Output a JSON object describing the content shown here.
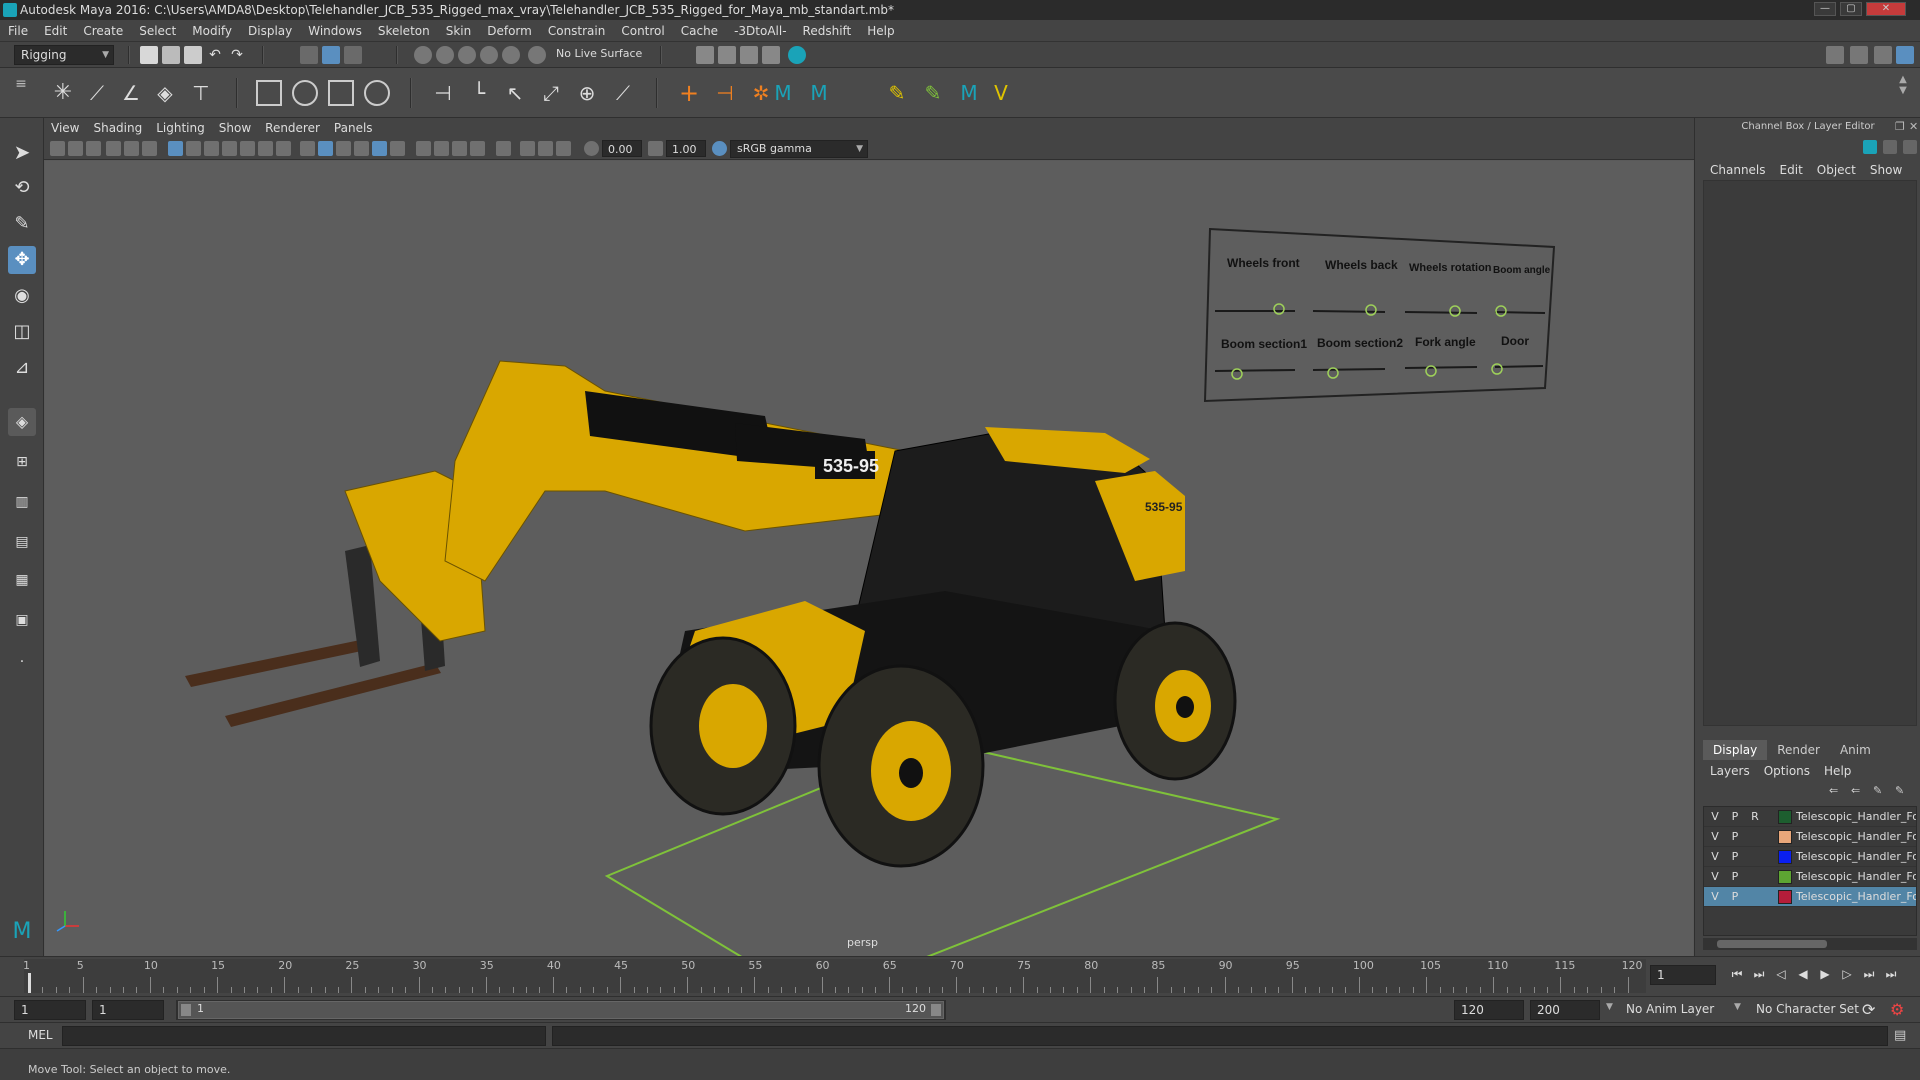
{
  "window": {
    "title": "Autodesk Maya 2016: C:\\Users\\AMDA8\\Desktop\\Telehandler_JCB_535_Rigged_max_vray\\Telehandler_JCB_535_Rigged_for_Maya_mb_standart.mb*",
    "minimize": "—",
    "maximize": "▢",
    "close": "✕"
  },
  "menubar": [
    "File",
    "Edit",
    "Create",
    "Select",
    "Modify",
    "Display",
    "Windows",
    "Skeleton",
    "Skin",
    "Deform",
    "Constrain",
    "Control",
    "Cache",
    "-3DtoAll-",
    "Redshift",
    "Help"
  ],
  "statusline": {
    "menu_set": "Rigging",
    "live_surface": "No Live Surface"
  },
  "viewport_menu": [
    "View",
    "Shading",
    "Lighting",
    "Show",
    "Renderer",
    "Panels"
  ],
  "viewport_toolbar": {
    "exposure": "0.00",
    "gamma": "1.00",
    "color_space": "sRGB gamma"
  },
  "viewport": {
    "camera_label": "persp",
    "control_panel": {
      "labels": [
        "Wheels front",
        "Wheels back",
        "Wheels rotation",
        "Boom angle",
        "Boom section1",
        "Boom section2",
        "Fork angle",
        "Door"
      ]
    },
    "model_badges": [
      "535-95",
      "535-95"
    ]
  },
  "channel_box": {
    "header": "Channel Box / Layer Editor",
    "tabs": [
      "Channels",
      "Edit",
      "Object",
      "Show"
    ]
  },
  "layer_editor": {
    "tabs": [
      "Display",
      "Render",
      "Anim"
    ],
    "active_tab": "Display",
    "menu": [
      "Layers",
      "Options",
      "Help"
    ],
    "layers": [
      {
        "v": "V",
        "p": "P",
        "r": "R",
        "color": "#1d5e2f",
        "name": "Telescopic_Handler_Fo",
        "selected": false
      },
      {
        "v": "V",
        "p": "P",
        "r": "",
        "color": "#e9a77a",
        "name": "Telescopic_Handler_Fo",
        "selected": false
      },
      {
        "v": "V",
        "p": "P",
        "r": "",
        "color": "#0a1ff0",
        "name": "Telescopic_Handler_Fo",
        "selected": false
      },
      {
        "v": "V",
        "p": "P",
        "r": "",
        "color": "#5da532",
        "name": "Telescopic_Handler_Fo",
        "selected": false
      },
      {
        "v": "V",
        "p": "P",
        "r": "",
        "color": "#b51d3a",
        "name": "Telescopic_Handler_Fo",
        "selected": true
      }
    ]
  },
  "timeline": {
    "ticks": [
      "1",
      "5",
      "10",
      "15",
      "20",
      "25",
      "30",
      "35",
      "40",
      "45",
      "50",
      "55",
      "60",
      "65",
      "70",
      "75",
      "80",
      "85",
      "90",
      "95",
      "100",
      "105",
      "110",
      "115",
      "120"
    ],
    "current_frame": "1"
  },
  "range": {
    "start": "1",
    "anim_start": "1",
    "slider_start": "1",
    "slider_end": "120",
    "playback_end": "120",
    "anim_end": "200",
    "anim_layer": "No Anim Layer",
    "character_set": "No Character Set"
  },
  "commandline": {
    "language": "MEL"
  },
  "helpline": {
    "text": "Move Tool: Select an object to move."
  },
  "colors": {
    "jcb_yellow": "#d9a700",
    "ground_grid": "#7fc23a",
    "selection_blue": "#5285a6"
  }
}
